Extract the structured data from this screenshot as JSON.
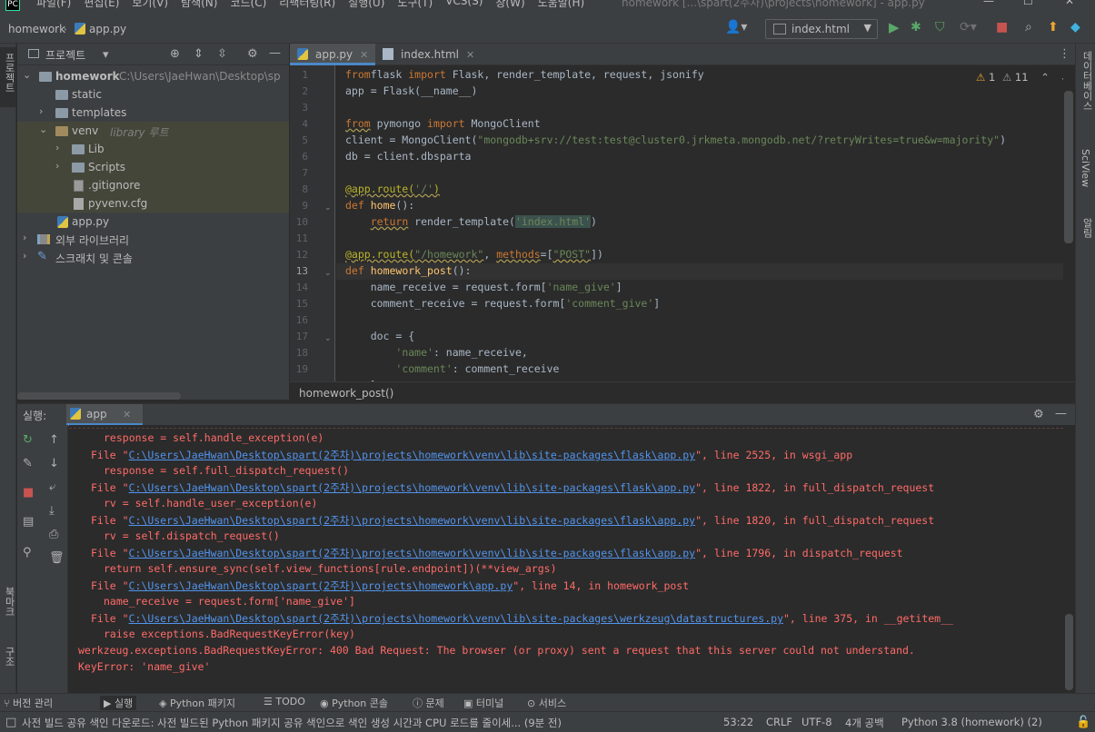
{
  "window": {
    "menu": [
      "파일(F)",
      "편집(E)",
      "보기(V)",
      "탐색(N)",
      "코드(C)",
      "리팩터링(R)",
      "실행(U)",
      "도구(T)",
      "VCS(S)",
      "창(W)",
      "도움말(H)"
    ],
    "title": "homework [...\\spart(2주차)\\projects\\homework] - app.py",
    "minimize": "—",
    "maximize": "☐",
    "close": "✕"
  },
  "nav": {
    "project": "homework",
    "file": "app.py",
    "run_config": "index.html"
  },
  "sidebar_left": {
    "project_label": "프로젝트",
    "bookmarks_label": "북마크",
    "structure_label": "구조"
  },
  "sidebar_right": {
    "database_label": "데이터베이스",
    "sciview_label": "SciView",
    "notifications_label": "알림"
  },
  "project_panel": {
    "title": "프로젝트",
    "tree": [
      {
        "name": "homework",
        "path": "C:\\Users\\JaeHwan\\Desktop\\sp"
      },
      {
        "name": "static"
      },
      {
        "name": "templates"
      },
      {
        "name": "venv",
        "annotation": "library 루트"
      },
      {
        "name": "Lib"
      },
      {
        "name": "Scripts"
      },
      {
        "name": ".gitignore"
      },
      {
        "name": "pyvenv.cfg"
      },
      {
        "name": "app.py"
      },
      {
        "name": "외부 라이브러리"
      },
      {
        "name": "스크래치 및 콘솔"
      }
    ]
  },
  "editor": {
    "tabs": [
      {
        "label": "app.py",
        "active": true
      },
      {
        "label": "index.html",
        "active": false
      }
    ],
    "inspections": {
      "warnings": "1",
      "weak_warnings": "11"
    },
    "current_line": "13",
    "line_numbers": [
      "1",
      "2",
      "3",
      "4",
      "5",
      "6",
      "7",
      "8",
      "9",
      "10",
      "11",
      "12",
      "13",
      "14",
      "15",
      "16",
      "17",
      "18",
      "19"
    ],
    "breadcrumb": "homework_post()"
  },
  "run_panel": {
    "label": "실행:",
    "tab": "app",
    "console": [
      {
        "indent": 4,
        "text": "response = self.handle_exception(e)"
      },
      {
        "indent": 2,
        "pre": "File \"",
        "path": "C:\\Users\\JaeHwan\\Desktop\\spart(2주차)\\projects\\homework\\venv\\lib\\site-packages\\flask\\app.py",
        "post": "\", line 2525, in wsgi_app"
      },
      {
        "indent": 4,
        "text": "response = self.full_dispatch_request()"
      },
      {
        "indent": 2,
        "pre": "File \"",
        "path": "C:\\Users\\JaeHwan\\Desktop\\spart(2주차)\\projects\\homework\\venv\\lib\\site-packages\\flask\\app.py",
        "post": "\", line 1822, in full_dispatch_request"
      },
      {
        "indent": 4,
        "text": "rv = self.handle_user_exception(e)"
      },
      {
        "indent": 2,
        "pre": "File \"",
        "path": "C:\\Users\\JaeHwan\\Desktop\\spart(2주차)\\projects\\homework\\venv\\lib\\site-packages\\flask\\app.py",
        "post": "\", line 1820, in full_dispatch_request"
      },
      {
        "indent": 4,
        "text": "rv = self.dispatch_request()"
      },
      {
        "indent": 2,
        "pre": "File \"",
        "path": "C:\\Users\\JaeHwan\\Desktop\\spart(2주차)\\projects\\homework\\venv\\lib\\site-packages\\flask\\app.py",
        "post": "\", line 1796, in dispatch_request"
      },
      {
        "indent": 4,
        "text": "return self.ensure_sync(self.view_functions[rule.endpoint])(**view_args)"
      },
      {
        "indent": 2,
        "pre": "File \"",
        "path": "C:\\Users\\JaeHwan\\Desktop\\spart(2주차)\\projects\\homework\\app.py",
        "post": "\", line 14, in homework_post"
      },
      {
        "indent": 4,
        "text": "name_receive = request.form['name_give']"
      },
      {
        "indent": 2,
        "pre": "File \"",
        "path": "C:\\Users\\JaeHwan\\Desktop\\spart(2주차)\\projects\\homework\\venv\\lib\\site-packages\\werkzeug\\datastructures.py",
        "post": "\", line 375, in __getitem__"
      },
      {
        "indent": 4,
        "text": "raise exceptions.BadRequestKeyError(key)"
      },
      {
        "indent": 0,
        "text": "werkzeug.exceptions.BadRequestKeyError: 400 Bad Request: The browser (or proxy) sent a request that this server could not understand."
      },
      {
        "indent": 0,
        "text": "KeyError: 'name_give'"
      }
    ]
  },
  "bottom_tabs": [
    "버전 관리",
    "실행",
    "Python 패키지",
    "TODO",
    "Python 콘솔",
    "문제",
    "터미널",
    "서비스"
  ],
  "status": {
    "message": "사전 빌드 공유 색인 다운로드: 사전 빌드된 Python 패키지 공유 색인으로 색인 생성 시간과 CPU 로드를 줄이세... (9분 전)",
    "position": "53:22",
    "line_sep": "CRLF",
    "encoding": "UTF-8",
    "indent": "4개 공백",
    "interpreter": "Python 3.8 (homework) (2)"
  }
}
